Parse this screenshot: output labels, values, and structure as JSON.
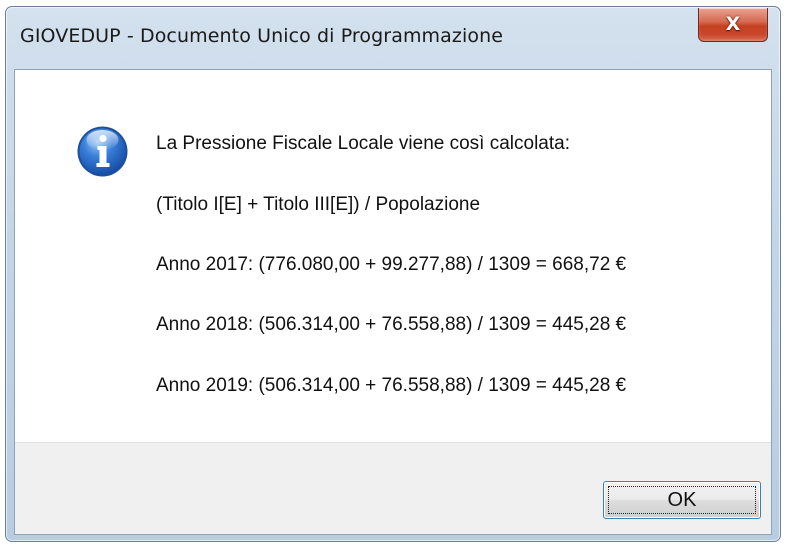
{
  "window": {
    "title": "GIOVEDUP - Documento Unico di Programmazione",
    "close_glyph": "X"
  },
  "icon": "info-icon",
  "message": {
    "lines": [
      "La Pressione Fiscale Locale viene così calcolata:",
      "(Titolo I[E] + Titolo III[E]) / Popolazione",
      "Anno 2017: (776.080,00 + 99.277,88) / 1309 = 668,72 €",
      "Anno 2018: (506.314,00 + 76.558,88) / 1309 = 445,28 €",
      "Anno 2019: (506.314,00 + 76.558,88) / 1309 = 445,28 €"
    ]
  },
  "buttons": {
    "ok_label": "OK"
  },
  "colors": {
    "titlebar": "#c2d5e8",
    "close_button": "#c4401f",
    "info_icon": "#2f6fd0",
    "button_bar": "#f0f0f0"
  }
}
